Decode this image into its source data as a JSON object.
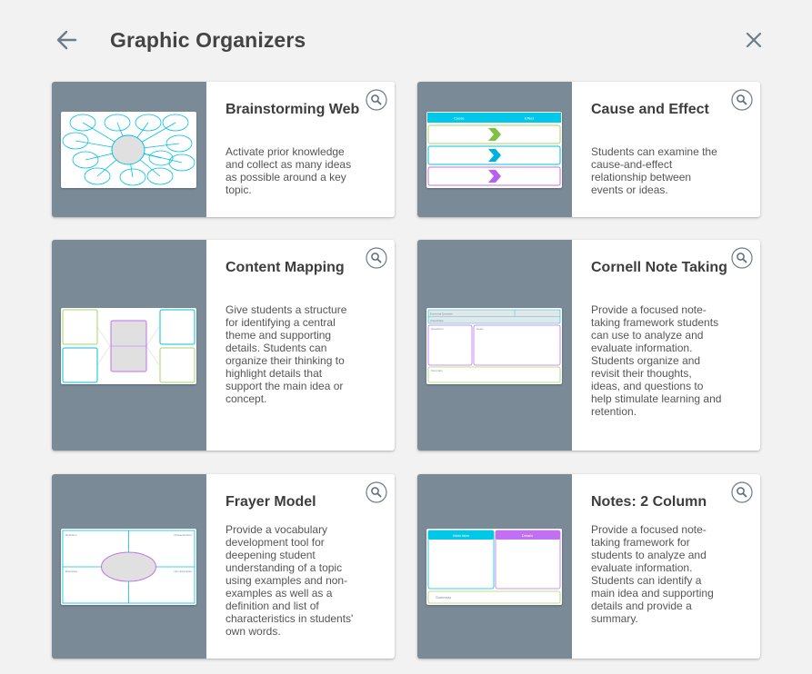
{
  "header": {
    "title": "Graphic Organizers",
    "back_icon": "arrow-left-icon",
    "close_icon": "close-icon"
  },
  "colors": {
    "background": "#f2f2f2",
    "thumb_bg": "#7a8a97",
    "cyan": "#00c0e0",
    "purple": "#c070f0",
    "green": "#8dc63f",
    "lime": "#a6d66a"
  },
  "cards": [
    {
      "title": "Brainstorming Web",
      "description": "Activate prior knowledge and collect as many ideas as possible around a key topic."
    },
    {
      "title": "Cause and Effect",
      "description": "Students can examine the cause-and-effect relationship between events or ideas."
    },
    {
      "title": "Content Mapping",
      "description": "Give students a structure for identifying a central theme and supporting details. Students can organize their thinking to highlight details that support the main idea or concept."
    },
    {
      "title": "Cornell Note Taking",
      "description": "Provide a focused note-taking framework students can use to analyze and evaluate information. Students organize and revisit their thoughts, ideas, and questions to help stimulate learning and retention."
    },
    {
      "title": "Frayer Model",
      "description": "Provide a vocabulary development tool for deepening student understanding of a topic using examples and non-examples as well as a definition and list of characteristics in students' own words."
    },
    {
      "title": "Notes: 2 Column",
      "description": "Provide a focused note-taking framework for students to analyze and evaluate information. Students can identify a main idea and supporting details and provide a summary."
    }
  ],
  "previews": {
    "cause_effect": {
      "left_head": "Cause",
      "right_head": "Effect"
    },
    "cornell": {
      "top_left": "Essential Question",
      "top_row2": "Class/Date",
      "main_left": "Questions",
      "main_right": "Notes",
      "bottom": "Summary"
    },
    "frayer": {
      "tl": "Definition",
      "tr": "Characteristics",
      "bl": "Examples",
      "br": "Non-Examples"
    },
    "two_col": {
      "left_head": "Main Idea",
      "right_head": "Details",
      "bottom": "Summary"
    }
  }
}
